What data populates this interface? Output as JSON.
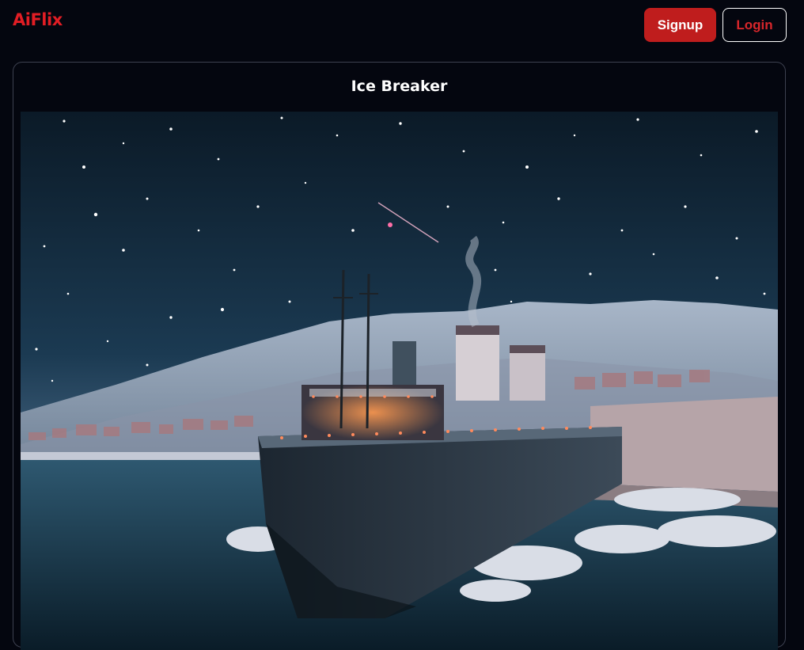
{
  "header": {
    "logo_text": "AiFlix",
    "signup_label": "Signup",
    "login_label": "Login"
  },
  "movie": {
    "title": "Ice Breaker",
    "poster_alt": "Ice Breaker"
  },
  "colors": {
    "brand": "#e11d24",
    "signup_bg": "#bf1d1d",
    "page_bg": "#04060f",
    "card_border": "#3d4150"
  }
}
